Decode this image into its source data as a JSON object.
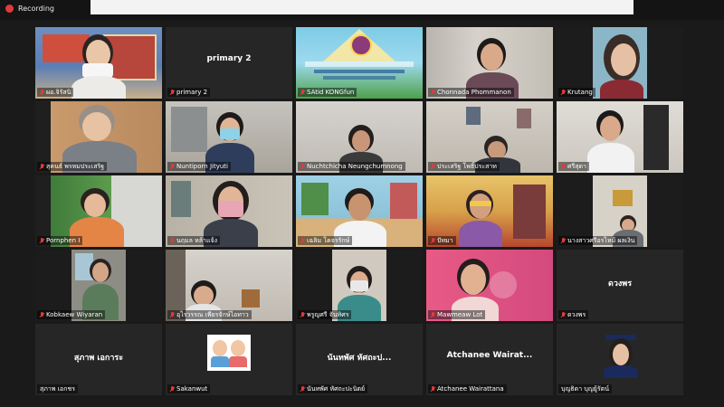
{
  "app": {
    "recording_label": "Recording"
  },
  "participants": [
    {
      "label": "ผอ.จิรัสนิ"
    },
    {
      "label": "primary 2",
      "display_name": "primary 2"
    },
    {
      "label": "SAtid KONGfun"
    },
    {
      "label": "Chonnada Phommanon"
    },
    {
      "label": "Krutang"
    },
    {
      "label": "สุคนธ์ พรหมประเสริฐ"
    },
    {
      "label": "Nuntiporn Jityuti"
    },
    {
      "label": "Nuchtchicha Neungchumnong"
    },
    {
      "label": "ประเสริฐ โพธิ์ประสาท"
    },
    {
      "label": "ศรีสุดา"
    },
    {
      "label": "Pornphen I"
    },
    {
      "label": "นฤมล หล้าแจ้ง"
    },
    {
      "label": "เฉลิม โคจรรักษ์"
    },
    {
      "label": "ปัทมา"
    },
    {
      "label": "นางสาวศรีอรไหม้ ผลเงิน"
    },
    {
      "label": "Kobkaew Wiyaran"
    },
    {
      "label": "อุไรวรรณ เพียรจักษ์ไอทาว"
    },
    {
      "label": "พรูญศรี จันทิศร"
    },
    {
      "label": "Mawmeaw Lot"
    },
    {
      "label": "ดวงพร",
      "display_name": "ดวงพร"
    },
    {
      "label": "สุภาพ เอกชร",
      "display_name": "สุภาพ เอการะ"
    },
    {
      "label": "Sakanwut"
    },
    {
      "label": "นันทพัศ หัศถะปะนิตย์",
      "display_name": "นันทพัศ หัศถะป..."
    },
    {
      "label": "Atchanee Wairattana",
      "display_name": "Atchanee Wairat..."
    },
    {
      "label": "บุญธิดา บุญยู้รัตน์"
    }
  ],
  "colors": {
    "active_speaker": "#f2d74a",
    "muted": "#e23a3a",
    "tile_bg": "#262626"
  }
}
